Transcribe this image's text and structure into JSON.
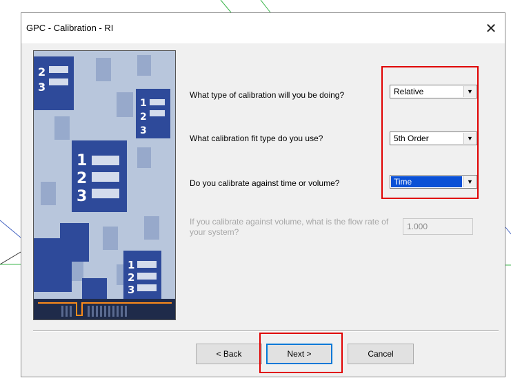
{
  "window": {
    "title": "GPC - Calibration - RI",
    "close_label": "✕"
  },
  "questions": [
    {
      "label": "What type of calibration will you be doing?",
      "value": "Relative",
      "selected": false
    },
    {
      "label": "What calibration fit type do you use?",
      "value": "5th Order",
      "selected": false
    },
    {
      "label": "Do you calibrate against time or volume?",
      "value": "Time",
      "selected": true
    }
  ],
  "flow_rate": {
    "label": "If you calibrate against volume, what is the flow rate of your system?",
    "value": "1.000",
    "disabled": true
  },
  "buttons": {
    "back": "< Back",
    "next": "Next >",
    "cancel": "Cancel"
  },
  "icons": {
    "dropdown": "▼"
  },
  "colors": {
    "highlight": "#e00000",
    "selection": "#0a50d6",
    "art_background": "#b8c6dc",
    "art_page": "#2e4a9a",
    "art_bar": "#ff8c1a"
  }
}
